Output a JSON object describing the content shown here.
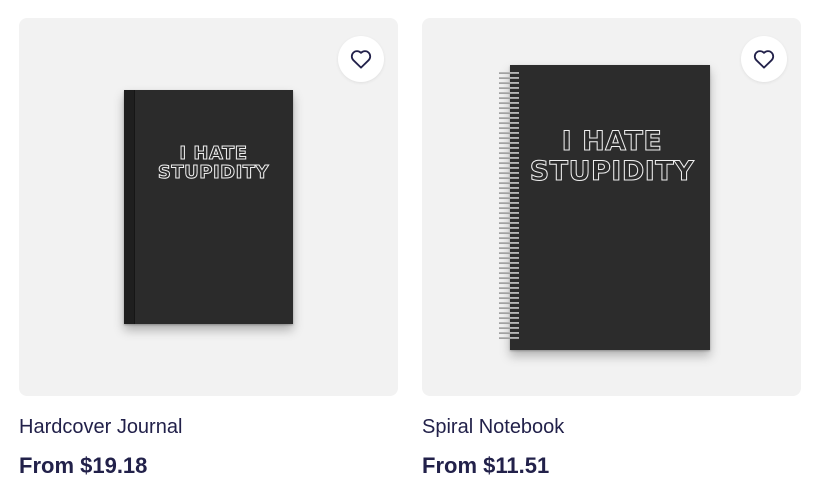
{
  "products": [
    {
      "title": "Hardcover Journal",
      "price": "From $19.18",
      "cover_text": [
        "I HATE",
        "STUPIDITY"
      ],
      "favorite_icon": "heart-outline-icon"
    },
    {
      "title": "Spiral Notebook",
      "price": "From $11.51",
      "cover_text": [
        "I HATE",
        "STUPIDITY"
      ],
      "favorite_icon": "heart-outline-icon"
    }
  ],
  "colors": {
    "tile_background": "#f2f2f2",
    "text_primary": "#22214a",
    "cover": "#2b2b2b"
  }
}
